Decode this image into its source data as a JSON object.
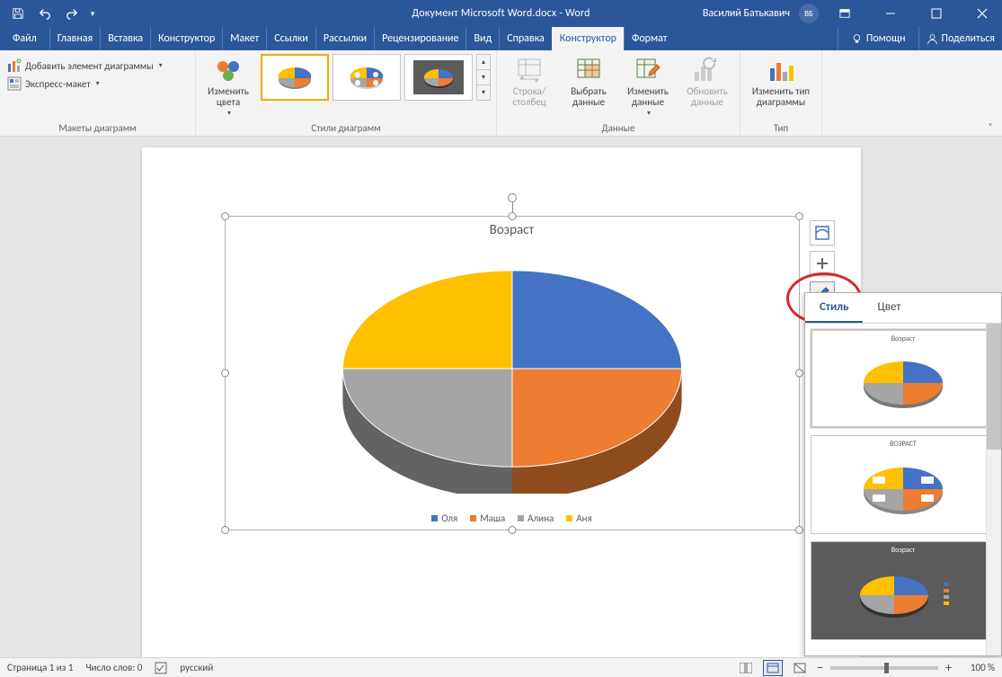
{
  "titlebar": {
    "title": "Документ Microsoft Word.docx  -  Word",
    "user_name": "Василий Батькавич",
    "user_initials": "ВБ"
  },
  "ribbon_tabs": {
    "file": "Файл",
    "home": "Главная",
    "insert": "Вставка",
    "design": "Конструктор",
    "layout": "Макет",
    "references": "Ссылки",
    "mailings": "Рассылки",
    "review": "Рецензирование",
    "view": "Вид",
    "help": "Справка",
    "chart_design": "Конструктор",
    "chart_format": "Формат",
    "tell_me": "Помощн",
    "share": "Поделиться"
  },
  "ribbon": {
    "layouts_group": "Макеты диаграмм",
    "add_element": "Добавить элемент диаграммы",
    "quick_layout": "Экспресс-макет",
    "change_colors": "Изменить цвета",
    "styles_group": "Стили диаграмм",
    "data_group": "Данные",
    "switch_rowcol": "Строка/ столбец",
    "select_data": "Выбрать данные",
    "edit_data": "Изменить данные",
    "refresh_data": "Обновить данные",
    "type_group": "Тип",
    "change_type": "Изменить тип диаграммы"
  },
  "flyout": {
    "tab_style": "Стиль",
    "tab_color": "Цвет"
  },
  "statusbar": {
    "page": "Страница 1 из 1",
    "words": "Число слов: 0",
    "language": "русский",
    "zoom": "100 %"
  },
  "chart_data": {
    "type": "pie",
    "title": "Возраст",
    "series": [
      {
        "name": "Оля",
        "value": 25,
        "color": "#4472C4"
      },
      {
        "name": "Маша",
        "value": 25,
        "color": "#ED7D31"
      },
      {
        "name": "Алина",
        "value": 25,
        "color": "#A5A5A5"
      },
      {
        "name": "Аня",
        "value": 25,
        "color": "#FFC000"
      }
    ],
    "style3d": true
  },
  "style_previews": {
    "t1": "Возраст",
    "t2": "ВОЗРАСТ",
    "t3": "Возраст"
  }
}
